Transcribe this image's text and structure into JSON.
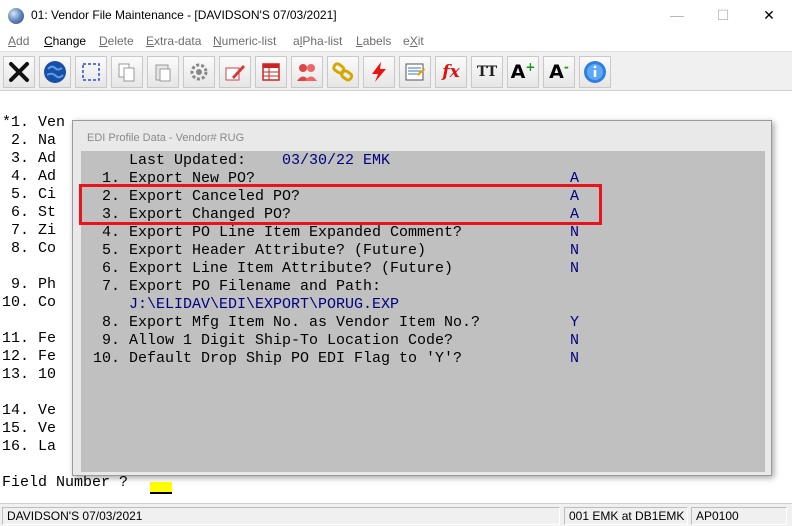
{
  "window": {
    "title": "01: Vendor File Maintenance - [DAVIDSON'S 07/03/2021]",
    "minimize": "—",
    "maximize": "☐",
    "close": "✕"
  },
  "menu": [
    {
      "label": "Add"
    },
    {
      "label": "Change"
    },
    {
      "label": "Delete"
    },
    {
      "label": "Extra-data"
    },
    {
      "label": "Numeric-list"
    },
    {
      "label": "alPha-list"
    },
    {
      "label": "Labels"
    },
    {
      "label": "eXit"
    }
  ],
  "toolbar": {
    "icons": [
      "exit-x-icon",
      "globe-icon",
      "select-icon",
      "copy-icon",
      "paste-icon",
      "settings-gear-icon",
      "edit-pencil-icon",
      "spreadsheet-icon",
      "users-icon",
      "link-chain-icon",
      "lightning-icon",
      "report-icon",
      "function-fx-icon",
      "font-size-icon",
      "font-increase-icon",
      "font-decrease-icon",
      "help-info-icon"
    ],
    "fx_text": "fx",
    "tt_text": "TT",
    "a_text": "A",
    "plus_text": "+",
    "minus_text": "-"
  },
  "background_lines": [
    {
      "text": "*1. Ven"
    },
    {
      "text": " 2. Na"
    },
    {
      "text": " 3. Ad"
    },
    {
      "text": " 4. Ad"
    },
    {
      "text": " 5. Ci"
    },
    {
      "text": " 6. St"
    },
    {
      "text": " 7. Zi"
    },
    {
      "text": " 8. Co"
    },
    {
      "text": " 9. Ph"
    },
    {
      "text": "10. Co"
    },
    {
      "text": "11. Fe"
    },
    {
      "text": "12. Fe"
    },
    {
      "text": "13. 10"
    },
    {
      "text": "14. Ve"
    },
    {
      "text": "15. Ve"
    },
    {
      "text": "16. La"
    }
  ],
  "field_prompt": "Field Number ? ",
  "dialog": {
    "title": "EDI Profile Data - Vendor#  RUG",
    "last_updated_label": "Last Updated:",
    "last_updated_value": "03/30/22 EMK",
    "items": [
      {
        "num": " 1.",
        "label": "Export New PO?",
        "value": "A"
      },
      {
        "num": " 2.",
        "label": "Export Canceled PO?",
        "value": "A"
      },
      {
        "num": " 3.",
        "label": "Export Changed PO?",
        "value": "A"
      },
      {
        "num": " 4.",
        "label": "Export PO Line Item Expanded Comment?",
        "value": "N"
      },
      {
        "num": " 5.",
        "label": "Export Header Attribute? (Future)",
        "value": "N"
      },
      {
        "num": " 6.",
        "label": "Export Line Item Attribute? (Future)",
        "value": "N"
      },
      {
        "num": " 7.",
        "label": "Export PO Filename and Path:",
        "value": ""
      },
      {
        "num": " 8.",
        "label": "Export Mfg Item No. as Vendor Item No.?",
        "value": "Y"
      },
      {
        "num": " 9.",
        "label": "Allow 1 Digit Ship-To Location Code?",
        "value": "N"
      },
      {
        "num": "10.",
        "label": "Default Drop Ship PO EDI Flag to 'Y'?",
        "value": "N"
      }
    ],
    "path_value": "J:\\ELIDAV\\EDI\\EXPORT\\PORUG.EXP"
  },
  "status": {
    "company": "DAVIDSON'S 07/03/2021",
    "session": "001 EMK at DB1EMK",
    "program": "AP0100"
  }
}
